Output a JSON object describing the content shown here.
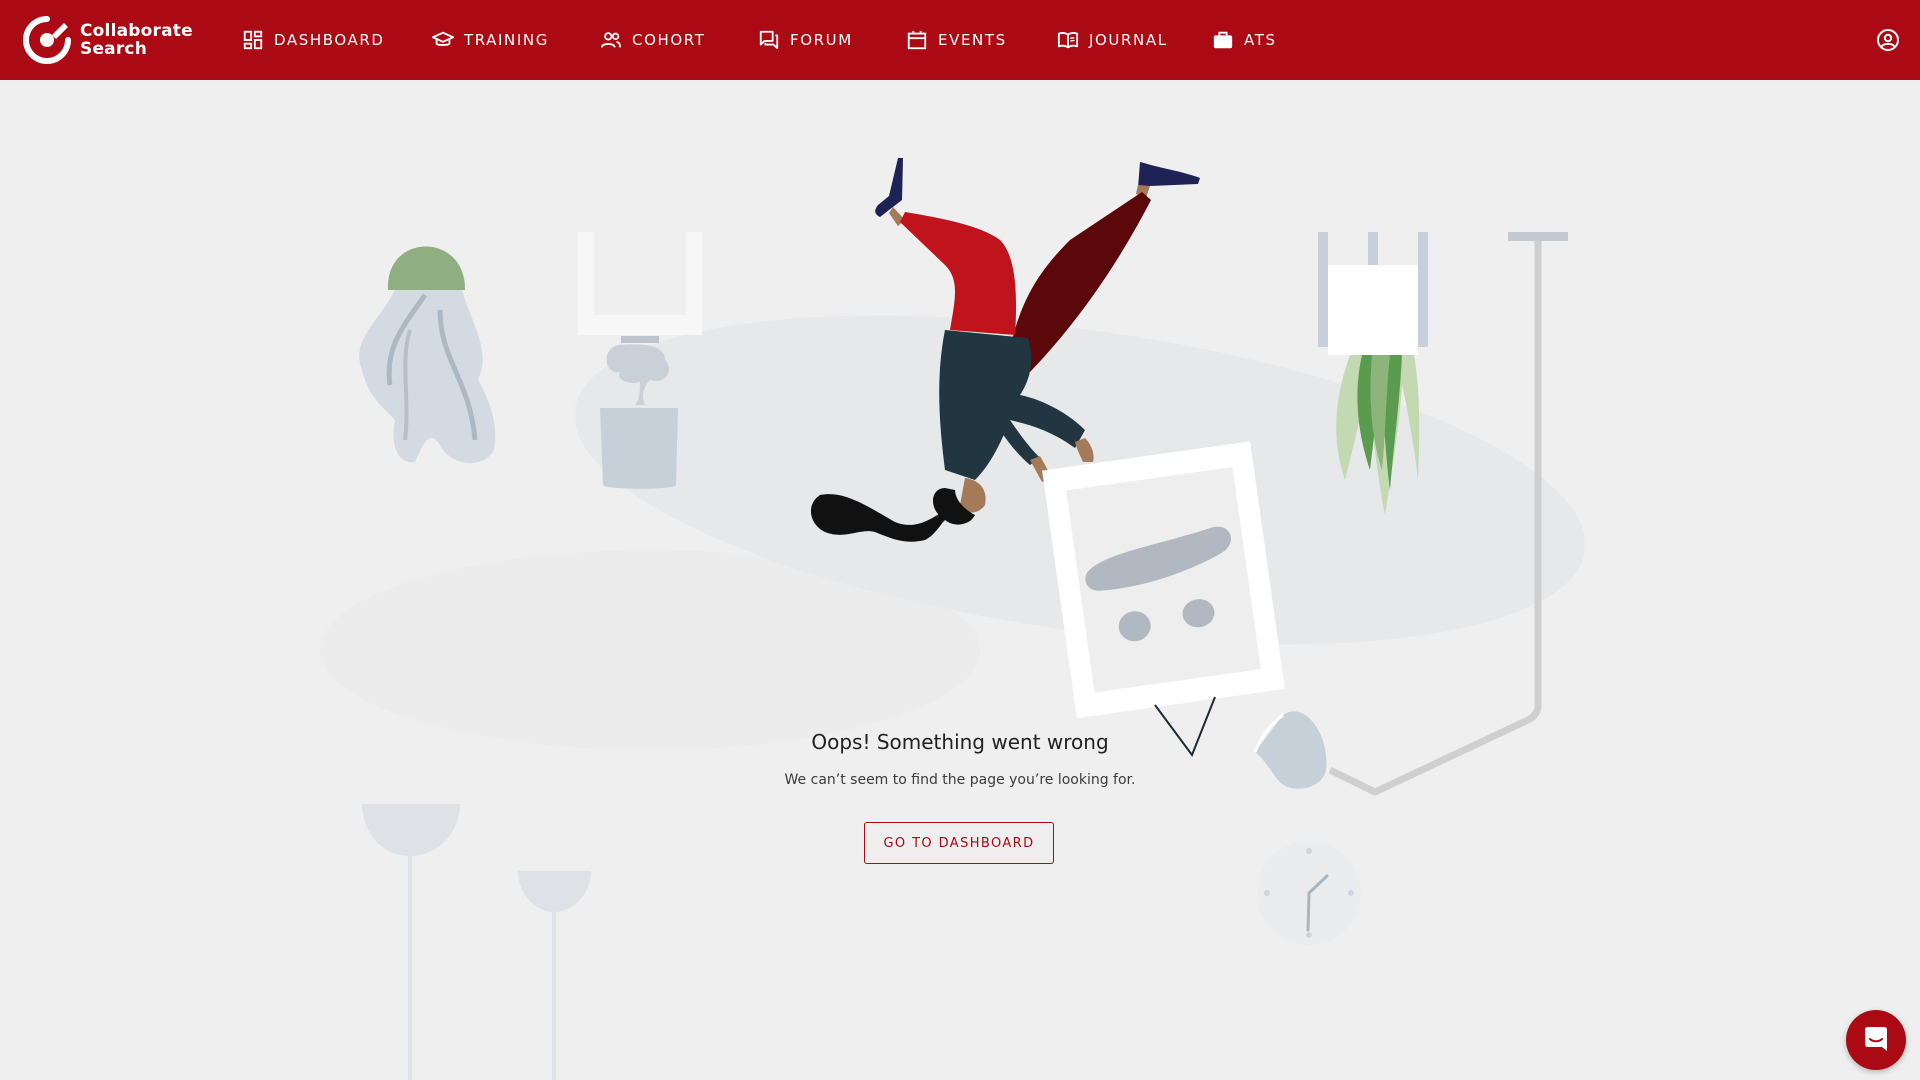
{
  "app": {
    "logo_line1": "Collaborate",
    "logo_line2": "Search",
    "brand_color": "#ab0a14"
  },
  "nav": {
    "items": [
      {
        "label": "DASHBOARD",
        "icon": "dashboard-icon"
      },
      {
        "label": "TRAINING",
        "icon": "graduation-cap-icon"
      },
      {
        "label": "COHORT",
        "icon": "people-icon"
      },
      {
        "label": "FORUM",
        "icon": "forum-icon"
      },
      {
        "label": "EVENTS",
        "icon": "calendar-icon"
      },
      {
        "label": "JOURNAL",
        "icon": "book-icon"
      },
      {
        "label": "ATS",
        "icon": "briefcase-icon"
      }
    ],
    "profile_icon": "account-circle-icon"
  },
  "error": {
    "title": "Oops! Something went wrong",
    "message": "We can’t seem to find the page you’re looking for.",
    "button_label": "GO TO DASHBOARD"
  },
  "chat": {
    "icon": "chat-icon"
  }
}
